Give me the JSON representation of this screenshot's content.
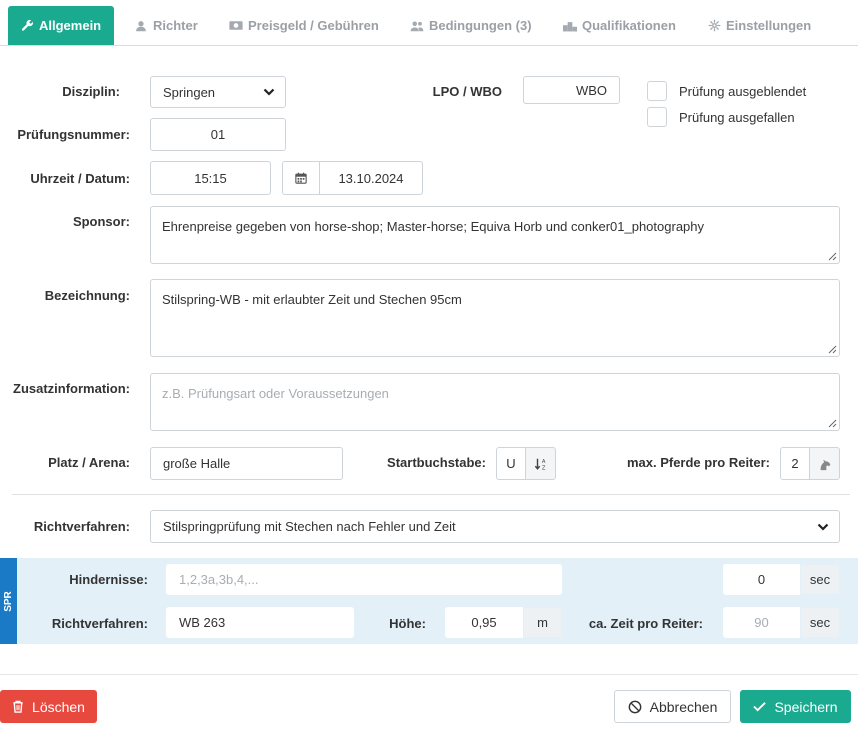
{
  "tabs": [
    {
      "label": "Allgemein",
      "icon": "wrench-icon"
    },
    {
      "label": "Richter",
      "icon": "judge-icon"
    },
    {
      "label": "Preisgeld / Gebühren",
      "icon": "money-icon"
    },
    {
      "label": "Bedingungen (3)",
      "icon": "users-icon"
    },
    {
      "label": "Qualifikationen",
      "icon": "podium-icon"
    },
    {
      "label": "Einstellungen",
      "icon": "gear-icon"
    }
  ],
  "form": {
    "disziplin_label": "Disziplin:",
    "disziplin_value": "Springen",
    "lpo_label": "LPO / WBO",
    "lpo_value": "WBO",
    "ausgeblendet_label": "Prüfung ausgeblendet",
    "ausgefallen_label": "Prüfung ausgefallen",
    "pruefungsnummer_label": "Prüfungsnummer:",
    "pruefungsnummer_value": "01",
    "uhrzeit_label": "Uhrzeit / Datum:",
    "uhrzeit_value": "15:15",
    "datum_value": "13.10.2024",
    "sponsor_label": "Sponsor:",
    "sponsor_value": "Ehrenpreise gegeben von horse-shop; Master-horse; Equiva Horb und conker01_photography",
    "bezeichnung_label": "Bezeichnung:",
    "bezeichnung_value": "Stilspring-WB - mit erlaubter Zeit und Stechen 95cm",
    "zusatz_label": "Zusatzinformation:",
    "zusatz_placeholder": "z.B. Prüfungsart oder Voraussetzungen",
    "platz_label": "Platz / Arena:",
    "platz_value": "große Halle",
    "startbuchstabe_label": "Startbuchstabe:",
    "startbuchstabe_value": "U",
    "max_pferde_label": "max. Pferde pro Reiter:",
    "max_pferde_value": "2",
    "richtverfahren_label": "Richtverfahren:",
    "richtverfahren_value": "Stilspringprüfung mit Stechen nach Fehler und Zeit"
  },
  "spr": {
    "tab_label": "SPR",
    "hindernisse_label": "Hindernisse:",
    "hindernisse_placeholder": "1,2,3a,3b,4,...",
    "hindernisse_sec_value": "0",
    "sec_unit": "sec",
    "richtverfahren_label": "Richtverfahren:",
    "richtverfahren_value": "WB 263",
    "hoehe_label": "Höhe:",
    "hoehe_value": "0,95",
    "hoehe_unit": "m",
    "zeit_label": "ca. Zeit pro Reiter:",
    "zeit_placeholder": "90",
    "zeit_unit": "sec"
  },
  "buttons": {
    "delete": "Löschen",
    "cancel": "Abbrechen",
    "save": "Speichern"
  },
  "colors": {
    "primary": "#1aaa8f",
    "danger": "#e8493f",
    "spr_accent": "#1b7ac5",
    "spr_panel": "#e4f0f8"
  }
}
